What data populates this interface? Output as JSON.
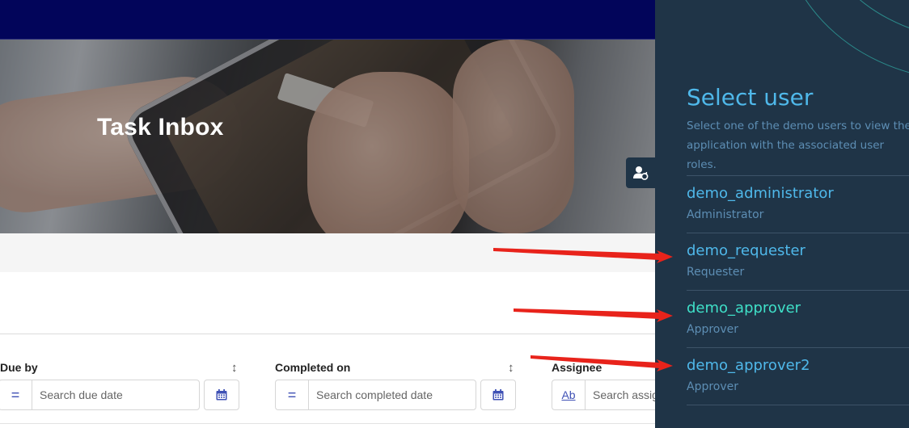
{
  "hero": {
    "title": "Task Inbox"
  },
  "filters": [
    {
      "label": "Due by",
      "operator": "=",
      "placeholder": "Search due date",
      "has_calendar": true
    },
    {
      "label": "Completed on",
      "operator": "=",
      "placeholder": "Search completed date",
      "has_calendar": true
    },
    {
      "label": "Assignee",
      "operator": "Ab",
      "placeholder": "Search assig",
      "has_calendar": false
    }
  ],
  "panel": {
    "title": "Select user",
    "description": "Select one of the demo users to view the application with the associated user roles.",
    "users": [
      {
        "name": "demo_administrator",
        "role": "Administrator",
        "selected": false
      },
      {
        "name": "demo_requester",
        "role": "Requester",
        "selected": false
      },
      {
        "name": "demo_approver",
        "role": "Approver",
        "selected": true
      },
      {
        "name": "demo_approver2",
        "role": "Approver",
        "selected": false
      }
    ]
  },
  "colors": {
    "navbar": "#02055a",
    "panel_bg": "#1f3447",
    "panel_accent": "#4fb8ea",
    "selected_user": "#3fe0c8",
    "annotation_arrow": "#e8231b"
  },
  "icons": {
    "user_toggle": "user-switch-icon",
    "sort": "sort-vertical-icon",
    "calendar": "calendar-icon"
  }
}
